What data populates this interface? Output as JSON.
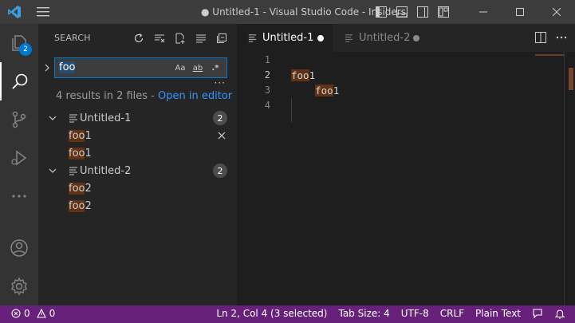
{
  "window": {
    "title": "● Untitled-1 - Visual Studio Code - Insiders"
  },
  "activity_bar": {
    "explorer_badge": "2"
  },
  "sidebar": {
    "header": "SEARCH",
    "search": {
      "value": "foo",
      "opt_case": "Aa",
      "opt_word": "ab",
      "opt_regex": ".*"
    },
    "more": "···",
    "results_message": "4 results in 2 files - ",
    "open_in_editor": "Open in editor",
    "files": [
      {
        "name": "Untitled-1",
        "count": "2",
        "matches": [
          {
            "pre": "",
            "match": "foo",
            "post": "1"
          },
          {
            "pre": "",
            "match": "foo",
            "post": "1"
          }
        ]
      },
      {
        "name": "Untitled-2",
        "count": "2",
        "matches": [
          {
            "pre": "",
            "match": "foo",
            "post": "2"
          },
          {
            "pre": "",
            "match": "foo",
            "post": "2"
          }
        ]
      }
    ]
  },
  "editor": {
    "tabs": [
      {
        "label": "Untitled-1",
        "dirty": true,
        "active": true
      },
      {
        "label": "Untitled-2",
        "dirty": true,
        "active": false
      }
    ],
    "line_numbers": [
      "1",
      "2",
      "3",
      "4"
    ],
    "lines": [
      {
        "indent": "",
        "match": "",
        "post": ""
      },
      {
        "indent": "",
        "match": "foo",
        "post": "1"
      },
      {
        "indent": "    ",
        "match": "foo",
        "post": "1"
      },
      {
        "indent": "",
        "match": "",
        "post": ""
      }
    ]
  },
  "status": {
    "errors": "0",
    "warnings": "0",
    "position": "Ln 2, Col 4 (3 selected)",
    "tab_size": "Tab Size: 4",
    "encoding": "UTF-8",
    "eol": "CRLF",
    "language": "Plain Text"
  },
  "colors": {
    "status_bar": "#68217a",
    "accent": "#0078d4",
    "link": "#3794ff",
    "find_match": "#613214"
  }
}
